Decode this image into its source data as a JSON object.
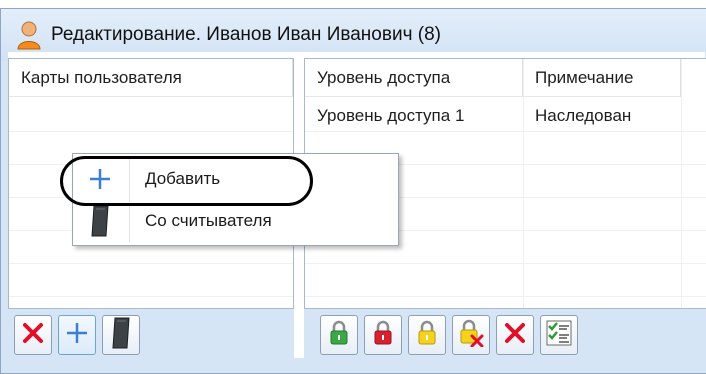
{
  "window": {
    "title": "Редактирование. Иванов Иван Иванович (8)",
    "icon": "user-icon"
  },
  "cards_panel": {
    "header": "Карты пользователя",
    "rows": []
  },
  "access_panel": {
    "columns": [
      "Уровень доступа",
      "Примечание"
    ],
    "rows": [
      {
        "level": "Уровень доступа 1",
        "note": "Наследован"
      }
    ]
  },
  "context_menu": {
    "items": [
      {
        "label": "Добавить",
        "icon": "plus-icon"
      },
      {
        "label": "Со считывателя",
        "icon": "card-reader-icon"
      }
    ]
  },
  "cards_toolbar": {
    "buttons": [
      "delete-icon",
      "plus-icon",
      "card-reader-icon"
    ]
  },
  "access_toolbar": {
    "buttons": [
      "lock-green-icon",
      "lock-red-icon",
      "lock-yellow-icon",
      "lock-remove-icon",
      "delete-icon",
      "checklist-icon"
    ]
  },
  "colors": {
    "window_bg": "#d6e5f5",
    "delete_red": "#e0102a",
    "plus_blue": "#3b7fd4",
    "lock_green": "#3aa845",
    "lock_red": "#d8202e",
    "lock_yellow": "#f5d21b"
  }
}
